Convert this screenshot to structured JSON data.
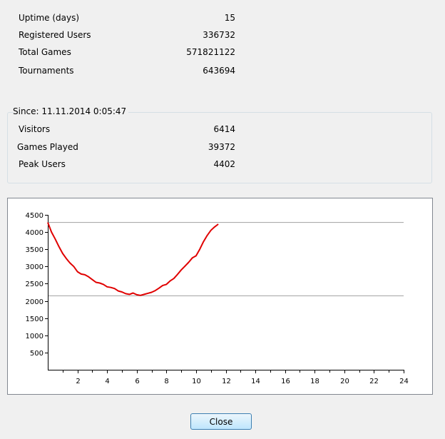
{
  "stats": [
    {
      "label": "Uptime (days)",
      "value": "15"
    },
    {
      "label": "Registered Users",
      "value": "336732"
    },
    {
      "label": "Total Games",
      "value": "571821122"
    },
    {
      "label": "Tournaments",
      "value": "643694"
    }
  ],
  "since": {
    "title": "Since: 11.11.2014 0:05:47",
    "items": [
      {
        "label": "Visitors",
        "value": "6414"
      },
      {
        "label": "Games Played",
        "value": "39372"
      },
      {
        "label": "Peak Users",
        "value": "4402"
      }
    ]
  },
  "chart_data": {
    "type": "line",
    "title": "",
    "xlabel": "",
    "ylabel": "",
    "xlim": [
      0,
      24
    ],
    "ylim": [
      0,
      4500
    ],
    "x_ticks": [
      2,
      4,
      6,
      8,
      10,
      12,
      14,
      16,
      18,
      20,
      22,
      24
    ],
    "y_ticks": [
      500,
      1000,
      1500,
      2000,
      2500,
      3000,
      3500,
      4000,
      4500
    ],
    "reference_lines": [
      4280,
      2150
    ],
    "series": [
      {
        "color": "#e00000",
        "x": [
          0,
          0.25,
          0.5,
          0.75,
          1,
          1.25,
          1.5,
          1.75,
          2,
          2.25,
          2.5,
          2.75,
          3,
          3.25,
          3.5,
          3.75,
          4,
          4.25,
          4.5,
          4.75,
          5,
          5.25,
          5.5,
          5.75,
          6,
          6.25,
          6.5,
          6.75,
          7,
          7.25,
          7.5,
          7.75,
          8,
          8.25,
          8.5,
          8.75,
          9,
          9.25,
          9.5,
          9.75,
          10,
          10.25,
          10.5,
          10.75,
          11,
          11.25,
          11.5
        ],
        "y": [
          4280,
          4000,
          3800,
          3580,
          3380,
          3230,
          3100,
          3000,
          2850,
          2780,
          2760,
          2700,
          2620,
          2540,
          2520,
          2480,
          2410,
          2390,
          2360,
          2290,
          2260,
          2210,
          2190,
          2230,
          2180,
          2160,
          2190,
          2220,
          2250,
          2300,
          2370,
          2450,
          2480,
          2580,
          2650,
          2770,
          2900,
          3010,
          3120,
          3250,
          3310,
          3500,
          3720,
          3900,
          4050,
          4150,
          4230
        ]
      }
    ]
  },
  "close_label": "Close"
}
